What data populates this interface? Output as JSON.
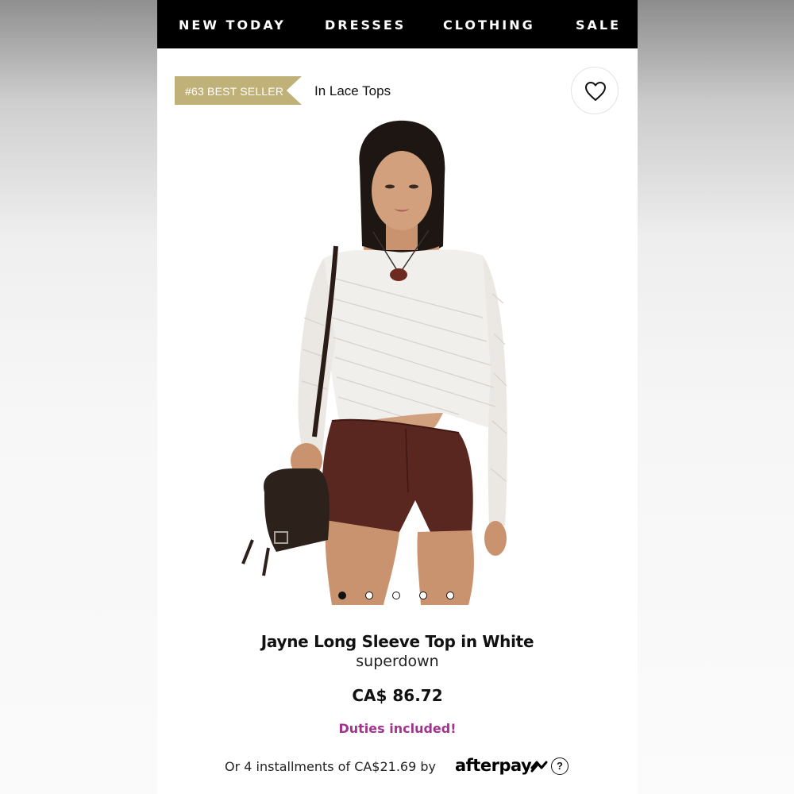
{
  "nav": {
    "items": [
      "NEW TODAY",
      "DRESSES",
      "CLOTHING",
      "SALE"
    ]
  },
  "badge": {
    "label": "#63 BEST SELLER",
    "category": "In Lace Tops",
    "color": "#bfb177"
  },
  "icons": {
    "favorite": "heart-outline-icon",
    "help": "question-circle-icon"
  },
  "gallery": {
    "total_images": 5,
    "active_index": 0
  },
  "product": {
    "title": "Jayne Long Sleeve Top in White",
    "brand": "superdown",
    "price": "CA$ 86.72",
    "duties": "Duties included!",
    "duties_color": "#a2338e",
    "installments_text": "Or 4 installments of CA$21.69 by",
    "installments_provider": "afterpay",
    "help_glyph": "?"
  }
}
